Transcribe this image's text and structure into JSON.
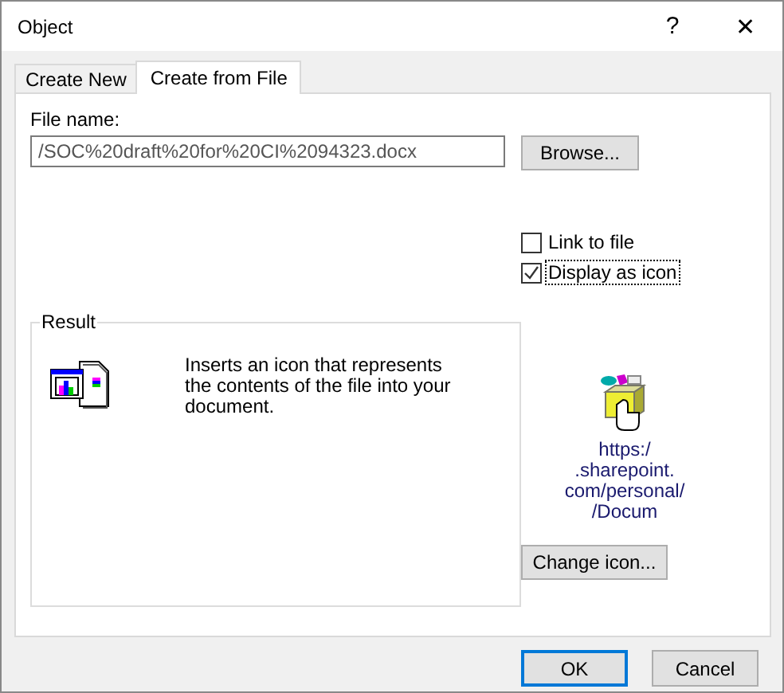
{
  "window": {
    "title": "Object",
    "help": "?",
    "close": "✕"
  },
  "tabs": [
    {
      "label": "Create New",
      "selected": false
    },
    {
      "label": "Create from File",
      "selected": true
    }
  ],
  "file_name": {
    "label": "File name:",
    "value": "/SOC%20draft%20for%20CI%2094323.docx"
  },
  "browse_button": "Browse...",
  "options": [
    {
      "label": "Link to file",
      "checked": false
    },
    {
      "label": "Display as icon",
      "checked": true
    }
  ],
  "result": {
    "title": "Result",
    "text": "Inserts an icon that represents the contents of the file into your document."
  },
  "icon_caption": [
    "https:/",
    ".sharepoint.",
    "com/personal/",
    "/Docum"
  ],
  "change_icon_button": "Change icon...",
  "buttons": [
    "OK",
    "Cancel"
  ]
}
